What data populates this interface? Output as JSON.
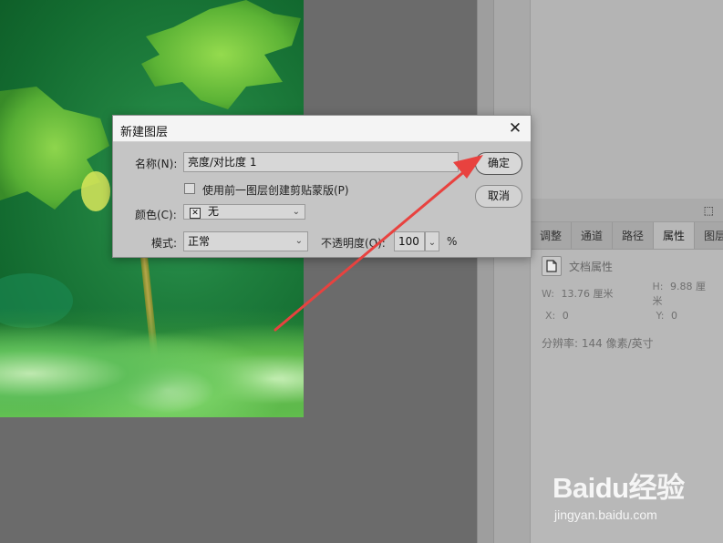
{
  "dialog": {
    "title": "新建图层",
    "name_label": "名称(N):",
    "name_value": "亮度/对比度 1",
    "clip_checkbox_label": "使用前一图层创建剪贴蒙版(P)",
    "color_label": "颜色(C):",
    "color_value": "无",
    "mode_label": "模式:",
    "mode_value": "正常",
    "opacity_label": "不透明度(O):",
    "opacity_value": "100",
    "opacity_unit": "%",
    "ok_label": "确定",
    "cancel_label": "取消",
    "close_glyph": "✕"
  },
  "panel": {
    "tabs": [
      {
        "label": "调整",
        "active": false
      },
      {
        "label": "通道",
        "active": false
      },
      {
        "label": "路径",
        "active": false
      },
      {
        "label": "属性",
        "active": true
      },
      {
        "label": "图层",
        "active": false
      }
    ],
    "doc_props_label": "文档属性",
    "w_label": "W:",
    "w_value": "13.76 厘米",
    "h_label": "H:",
    "h_value": "9.88 厘米",
    "x_label": "X:",
    "x_value": "0",
    "y_label": "Y:",
    "y_value": "0",
    "resolution": "分辨率: 144 像素/英寸"
  },
  "watermark": {
    "brand_left": "Bai",
    "brand_mid": "du",
    "brand_right": "经验",
    "url": "jingyan.baidu.com"
  },
  "colors": {
    "annotation_arrow": "#e8423f",
    "dialog_bg": "#c5c5c5",
    "panel_bg": "#b8b8b8",
    "workspace_bg": "#6b6b6b"
  }
}
